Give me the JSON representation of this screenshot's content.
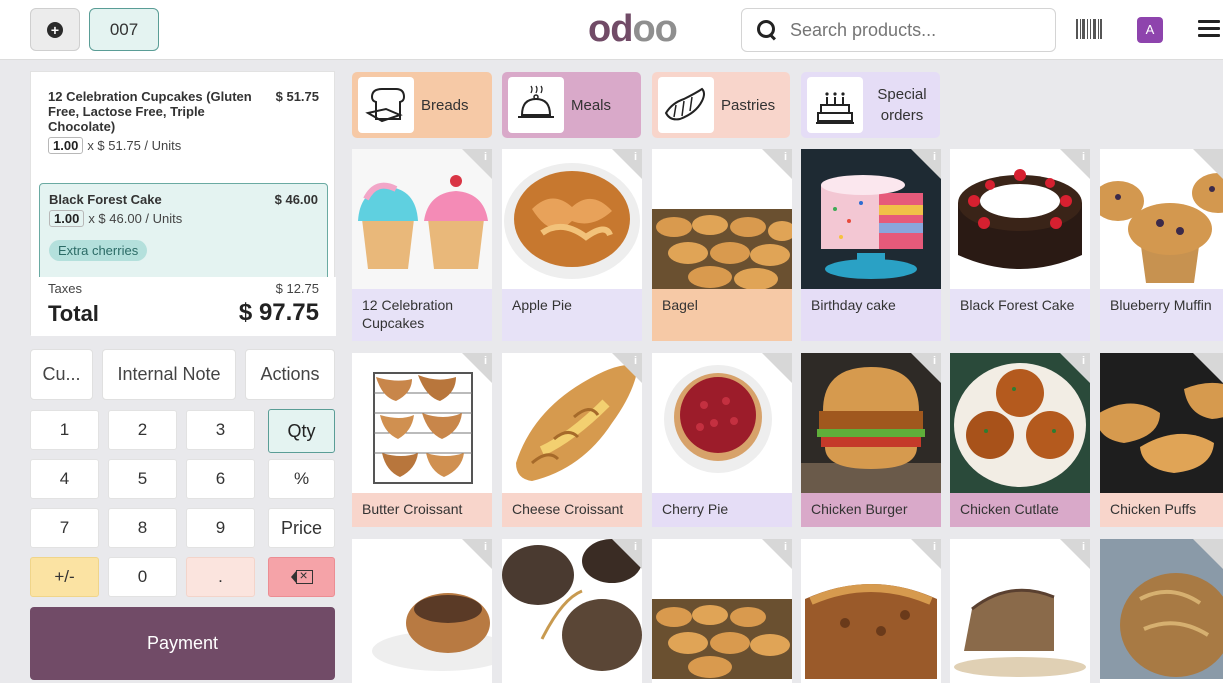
{
  "header": {
    "order_number": "007",
    "logo_part1": "od",
    "logo_part2": "oo",
    "search_placeholder": "Search products...",
    "user_initial": "A"
  },
  "order": {
    "lines": [
      {
        "name": "12 Celebration Cupcakes (Gluten Free, Lactose Free, Triple Chocolate)",
        "price": "$ 51.75",
        "qty": "1.00",
        "unit_text": "x $ 51.75 / Units"
      },
      {
        "name": "Black Forest Cake",
        "price": "$ 46.00",
        "qty": "1.00",
        "unit_text": "x $ 46.00 / Units",
        "note": "Extra cherries"
      }
    ],
    "taxes_label": "Taxes",
    "taxes_value": "$ 12.75",
    "total_label": "Total",
    "total_value": "$ 97.75"
  },
  "controls": {
    "customer": "Cu...",
    "internal_note": "Internal Note",
    "actions": "Actions"
  },
  "numpad": {
    "k1": "1",
    "k2": "2",
    "k3": "3",
    "qty": "Qty",
    "k4": "4",
    "k5": "5",
    "k6": "6",
    "pct": "%",
    "k7": "7",
    "k8": "8",
    "k9": "9",
    "price": "Price",
    "plusminus": "+/-",
    "k0": "0",
    "dot": "."
  },
  "payment_label": "Payment",
  "categories": [
    {
      "label": "Breads",
      "icon": "bread-icon"
    },
    {
      "label": "Meals",
      "icon": "cloche-icon"
    },
    {
      "label": "Pastries",
      "icon": "croissant-icon"
    },
    {
      "label": "Special orders",
      "icon": "cake-icon"
    }
  ],
  "products": [
    {
      "name": "12 Celebration Cupcakes"
    },
    {
      "name": "Apple Pie"
    },
    {
      "name": "Bagel"
    },
    {
      "name": "Birthday cake"
    },
    {
      "name": "Black Forest Cake"
    },
    {
      "name": "Blueberry Muffin"
    },
    {
      "name": "Butter Croissant"
    },
    {
      "name": "Cheese Croissant"
    },
    {
      "name": "Cherry Pie"
    },
    {
      "name": "Chicken Burger"
    },
    {
      "name": "Chicken Cutlate"
    },
    {
      "name": "Chicken Puffs"
    }
  ],
  "colors": {
    "brand": "#714b67",
    "accent_teal": "#5a9d96",
    "breads": "#f6c9a6",
    "meals": "#d9a9c9",
    "pastries": "#f8d5cb",
    "special": "#e5ddf6"
  }
}
